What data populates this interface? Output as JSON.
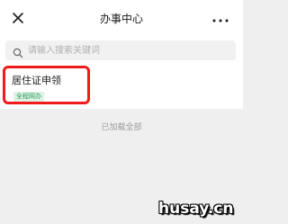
{
  "header": {
    "title": "办事中心",
    "close_icon": "close-icon",
    "more_icon": "more-icon"
  },
  "search": {
    "placeholder": "请输入搜索关键词",
    "value": "",
    "icon": "search-icon"
  },
  "list": {
    "items": [
      {
        "title": "居住证申领",
        "tag": "全程网办"
      }
    ]
  },
  "status": {
    "text": "已加载全部"
  },
  "watermark": {
    "text": "husay.cn"
  },
  "colors": {
    "highlight": "#ee1b1b",
    "tag_text": "#2a9a5a",
    "tag_bg": "#ddf2e5",
    "page_bg": "#efefef"
  }
}
